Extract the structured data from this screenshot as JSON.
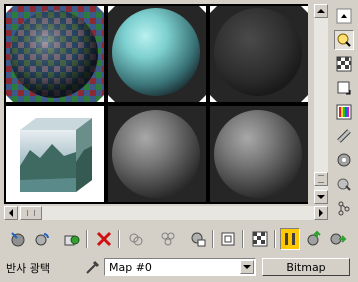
{
  "material_editor": {
    "slots": [
      {
        "name": "checker-sphere-slot",
        "type": "checker-sphere",
        "active": true
      },
      {
        "name": "teal-sphere-slot",
        "type": "sphere",
        "color": "#7ed0d0",
        "active": true
      },
      {
        "name": "dark-sphere-slot",
        "type": "sphere",
        "color": "#3a3a3a",
        "active": true
      },
      {
        "name": "landscape-cube-slot",
        "type": "cube",
        "active": false
      },
      {
        "name": "gray-sphere-slot-5",
        "type": "sphere",
        "color": "#777777",
        "active": false
      },
      {
        "name": "gray-sphere-slot-6",
        "type": "sphere",
        "color": "#777777",
        "active": false
      }
    ],
    "side_toolbar": [
      "sample-type-icon",
      "backlight-icon",
      "background-checker-icon",
      "uv-tiling-icon",
      "video-color-check-icon",
      "make-preview-icon",
      "options-icon",
      "select-by-material-icon",
      "material-map-navigator-icon"
    ],
    "bottom_toolbar": [
      "get-material-icon",
      "put-to-scene-icon",
      "assign-to-selection-icon",
      "reset-map-icon",
      "make-copy-icon",
      "make-unique-icon",
      "put-to-library-icon",
      "material-id-channel-icon",
      "show-map-in-viewport-icon",
      "show-end-result-icon",
      "go-to-parent-icon",
      "go-forward-to-sibling-icon"
    ],
    "map_label": "반사 광택",
    "map_combo_value": "Map #0",
    "bitmap_button": "Bitmap",
    "colors": {
      "panel": "#d4d0c8",
      "slot_bg": "#262626",
      "active_border": "#ffffff",
      "accent": "#ffc800"
    }
  }
}
